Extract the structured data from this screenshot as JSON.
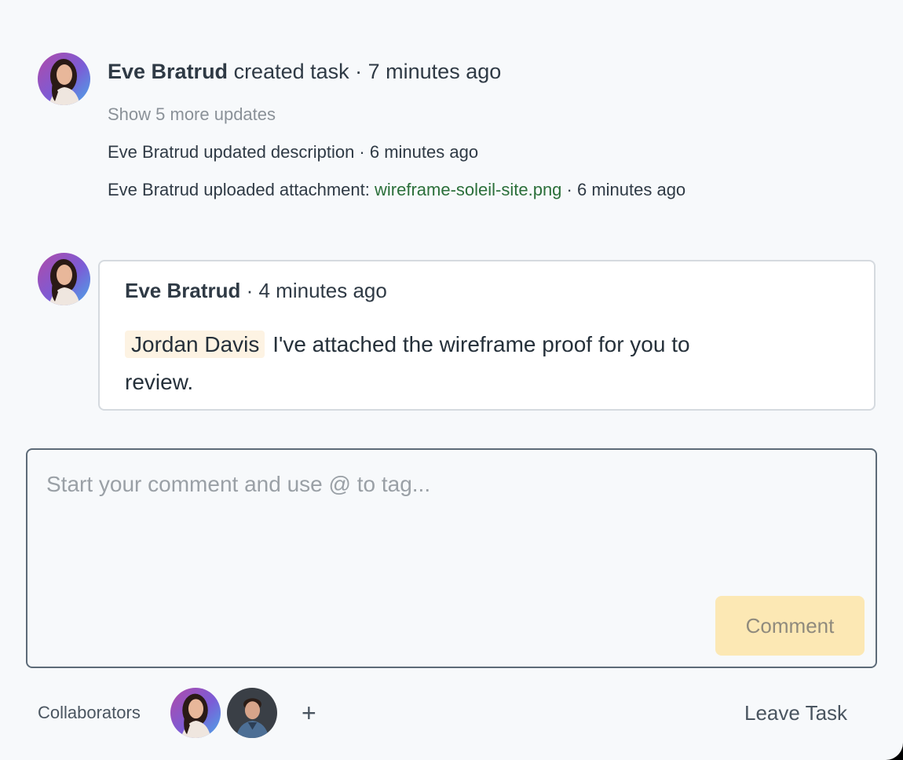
{
  "activity": {
    "created": {
      "name": "Eve Bratrud",
      "action": " created task",
      "time": " · 7 minutes ago"
    },
    "show_more": "Show 5 more updates",
    "update_description": "Eve Bratrud updated description · 6 minutes ago",
    "upload": {
      "prefix": "Eve Bratrud uploaded attachment: ",
      "file": "wireframe-soleil-site.png",
      "suffix": " · 6 minutes ago"
    }
  },
  "comment": {
    "author": "Eve Bratrud",
    "time": " · 4 minutes ago",
    "mention": "Jordan Davis",
    "text": "I've attached the wireframe proof for you to review."
  },
  "composer": {
    "placeholder": "Start your comment and use @ to tag...",
    "button": "Comment"
  },
  "footer": {
    "collaborators_label": "Collaborators",
    "add": "+",
    "leave": "Leave Task"
  },
  "colors": {
    "link_green": "#2b6f3a",
    "mention_bg": "#fdf3e3",
    "comment_button_bg": "#fce8b4"
  },
  "icons": {
    "avatar_eve": "woman-portrait-avatar",
    "avatar_jordan": "man-portrait-avatar",
    "add": "plus-icon"
  }
}
